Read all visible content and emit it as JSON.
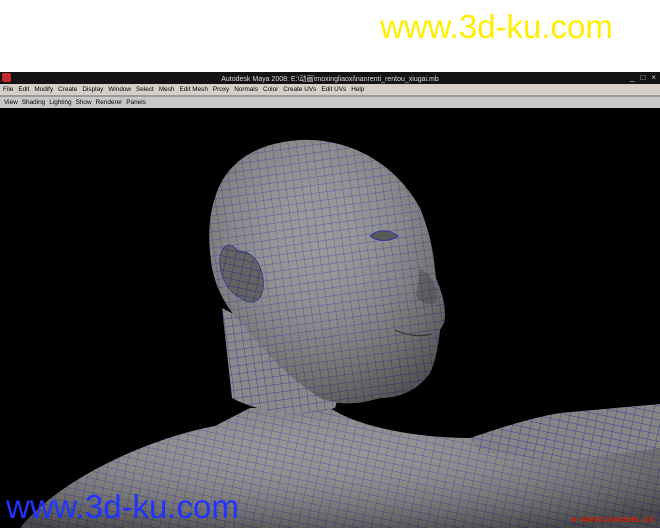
{
  "watermark": {
    "top": "www.3d-ku.com",
    "bottom": "www.3d-ku.com",
    "cg": "★ WWW.CGMODEL.CN"
  },
  "window": {
    "title": "Autodesk Maya 2008: E:\\动画\\moxingliaoxi\\nanrenti_rentou_xiugai.mb",
    "controls": [
      "_",
      "□",
      "×"
    ]
  },
  "menubar": [
    "File",
    "Edit",
    "Modify",
    "Create",
    "Display",
    "Window",
    "Select",
    "Mesh",
    "Edit Mesh",
    "Proxy",
    "Normals",
    "Color",
    "Create UVs",
    "Edit UVs",
    "Help"
  ],
  "panel_menu": [
    "View",
    "Shading",
    "Lighting",
    "Show",
    "Renderer",
    "Panels"
  ],
  "colors": {
    "wireframe": "#2a2aa8",
    "mesh": "#8a8a8a",
    "background": "#000000"
  }
}
